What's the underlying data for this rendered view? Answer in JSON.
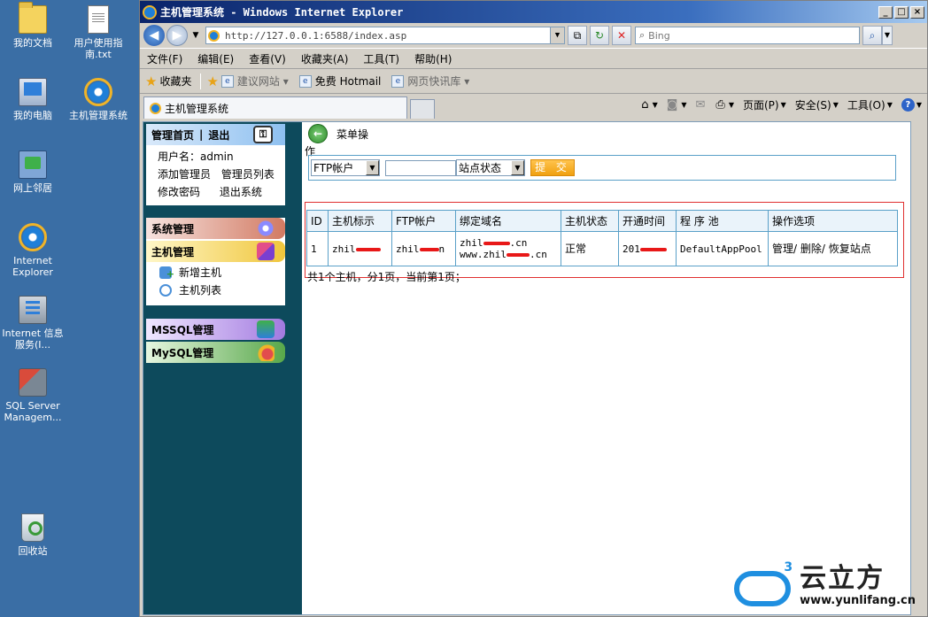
{
  "desktop": {
    "icons": [
      {
        "label": "我的文档",
        "icon": "folder-icon"
      },
      {
        "label": "用户使用指南.txt",
        "icon": "text-file-icon"
      },
      {
        "label": "我的电脑",
        "icon": "computer-icon"
      },
      {
        "label": "主机管理系统",
        "icon": "ie-shortcut-icon"
      },
      {
        "label": "网上邻居",
        "icon": "network-icon"
      },
      {
        "label": "Internet Explorer",
        "icon": "ie-icon"
      },
      {
        "label": "Internet 信息服务(I...",
        "icon": "iis-icon"
      },
      {
        "label": "SQL Server Managem...",
        "icon": "sql-tools-icon"
      },
      {
        "label": "回收站",
        "icon": "recycle-bin-icon"
      }
    ]
  },
  "window": {
    "title": "主机管理系统 - Windows Internet Explorer",
    "controls": [
      "_",
      "□",
      "×"
    ]
  },
  "address": {
    "url": "http://127.0.0.1:6588/index.asp",
    "search_placeholder": "Bing"
  },
  "menu": [
    "文件(F)",
    "编辑(E)",
    "查看(V)",
    "收藏夹(A)",
    "工具(T)",
    "帮助(H)"
  ],
  "favorites": {
    "label": "收藏夹",
    "items": [
      {
        "label": "建议网站 ▾",
        "muted": true
      },
      {
        "label": "免费 Hotmail",
        "muted": false
      },
      {
        "label": "网页快讯库 ▾",
        "muted": true
      }
    ]
  },
  "tab": {
    "title": "主机管理系统"
  },
  "commands": {
    "page": "页面(P)",
    "safety": "安全(S)",
    "tools": "工具(O)",
    "help": "?"
  },
  "sidebar": {
    "home": "管理首页",
    "divider": "|",
    "logout": "退出",
    "username_label": "用户名：admin",
    "links_row1": [
      "添加管理员",
      "管理员列表"
    ],
    "links_row2": [
      "修改密码",
      "退出系统"
    ],
    "groups": {
      "system": "系统管理",
      "host": "主机管理",
      "host_items": [
        "新增主机",
        "主机列表"
      ],
      "mssql": "MSSQL管理",
      "mysql": "MySQL管理"
    }
  },
  "main": {
    "header_line1": "菜单操",
    "header_line2": "作",
    "filter": {
      "select1": "FTP帐户",
      "select2": "站点状态",
      "submit": "提 交"
    },
    "table": {
      "headers": [
        "ID",
        "主机标示",
        "FTP帐户",
        "绑定域名",
        "主机状态",
        "开通时间",
        "程 序 池",
        "操作选项"
      ],
      "row": {
        "id": "1",
        "host_id": "zhil",
        "ftp": "zhil",
        "ftp_suffix": "n",
        "domain1_a": "zhil",
        "domain1_b": ".cn",
        "domain2_a": "www.zhil",
        "domain2_b": ".cn",
        "status": "正常",
        "open_time": "201",
        "pool": "DefaultAppPool",
        "actions": [
          "管理",
          "删除",
          "恢复站点"
        ]
      }
    },
    "pager": "共1个主机，分1页，当前第1页；"
  },
  "watermark": {
    "brand": "云立方",
    "url": "www.yunlifang.cn",
    "sup": "3"
  }
}
